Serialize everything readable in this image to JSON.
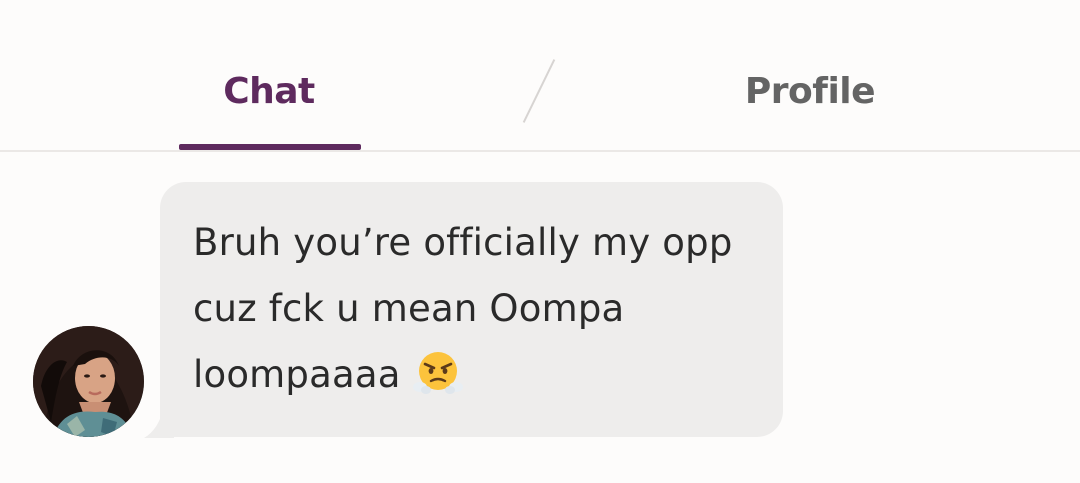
{
  "tabs": {
    "chat_label": "Chat",
    "profile_label": "Profile",
    "active": "Chat"
  },
  "message": {
    "text": "Bruh you’re officially my opp cuz fck u mean Oompa loompaaaa",
    "emoji": "face-with-steam-from-nose-icon",
    "direction": "incoming"
  },
  "colors": {
    "accent": "#5e2a5e",
    "inactive_tab": "#646464",
    "bubble": "#eeedec",
    "background": "#fdfcfb"
  }
}
